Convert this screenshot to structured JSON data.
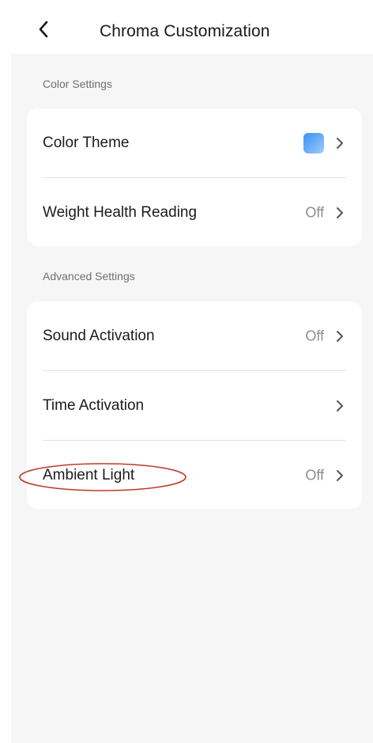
{
  "header": {
    "title": "Chroma Customization",
    "back_icon": "chevron-left-icon"
  },
  "sections": [
    {
      "label": "Color Settings",
      "rows": [
        {
          "label": "Color Theme",
          "value": "",
          "swatch_color": "#4a97f1"
        },
        {
          "label": "Weight Health Reading",
          "value": "Off"
        }
      ]
    },
    {
      "label": "Advanced Settings",
      "rows": [
        {
          "label": "Sound Activation",
          "value": "Off"
        },
        {
          "label": "Time Activation",
          "value": ""
        },
        {
          "label": "Ambient Light",
          "value": "Off"
        }
      ]
    }
  ],
  "annotation_color": "#c0392b"
}
